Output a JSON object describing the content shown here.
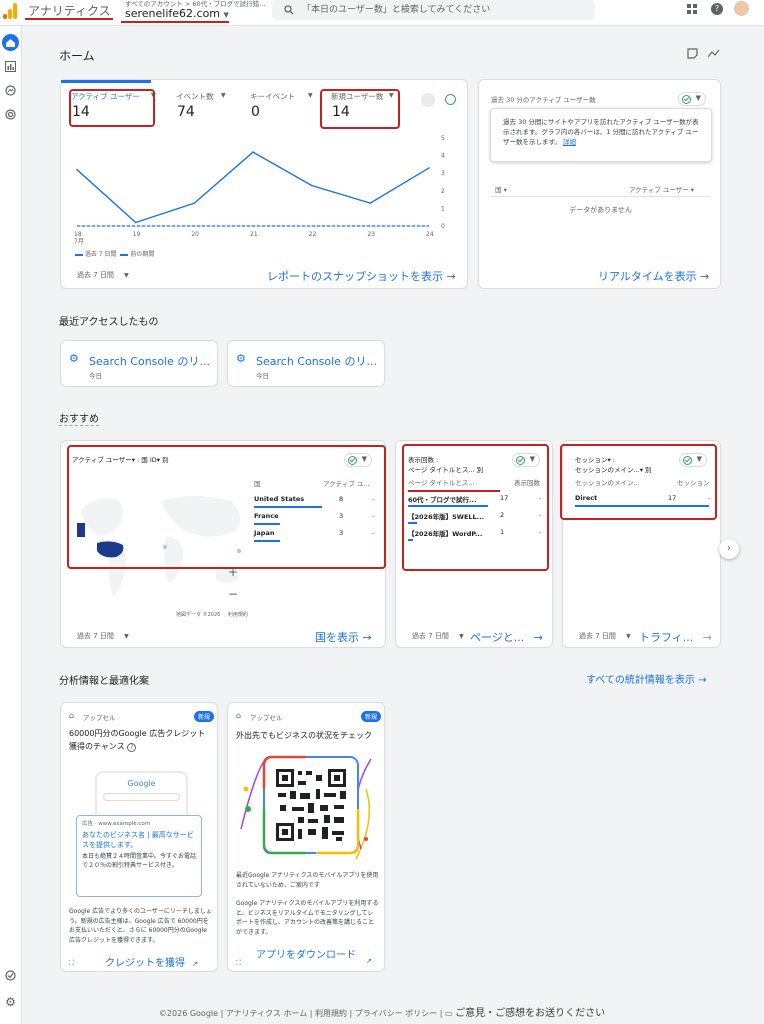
{
  "topbar": {
    "app_title": "アナリティクス",
    "account_path": "すべてのアカウント > 60代・ブログで試行錯...",
    "property_name": "serenelife62.com",
    "search_placeholder": "「本日のユーザー数」と検索してみてください"
  },
  "home": {
    "title": "ホーム"
  },
  "overview_card": {
    "metrics": [
      {
        "label": "アクティブ ユーザー",
        "value": "14"
      },
      {
        "label": "イベント数",
        "value": "74"
      },
      {
        "label": "キーイベント",
        "value": "0"
      },
      {
        "label": "新規ユーザー数",
        "value": "14"
      }
    ],
    "date_range": "過去 7 日間",
    "legend_current": "過去 7 日間",
    "legend_previous": "前の期間",
    "snapshot_link": "レポートのスナップショットを表示"
  },
  "chart_data": {
    "type": "line",
    "x": [
      "18",
      "19",
      "20",
      "21",
      "22",
      "23",
      "24"
    ],
    "x_month_label": "7月",
    "series": [
      {
        "name": "過去 7 日間",
        "values": [
          3.2,
          0.2,
          1.3,
          4.2,
          2.3,
          1.3,
          3.3
        ],
        "color": "#1a73e8",
        "style": "solid"
      },
      {
        "name": "前の期間",
        "values": [
          0,
          0,
          0,
          0,
          0,
          0,
          0
        ],
        "color": "#1a73e8",
        "style": "dashed"
      }
    ],
    "ylim": [
      0,
      5
    ],
    "yticks": [
      "5",
      "4",
      "3",
      "2",
      "1",
      "0"
    ]
  },
  "realtime_card": {
    "title": "過去 30 分のアクティブ ユーザー数",
    "tooltip_text": "過去 30 分間にサイトやアプリを訪れたアクティブ ユーザー数が表示されます。グラフ内の各バーは、1 分間に訪れたアクティブ ユーザー数を示します。",
    "tooltip_link": "詳細",
    "col_country": "国",
    "col_users": "アクティブ ユーザー",
    "empty": "データがありません",
    "link": "リアルタイムを表示"
  },
  "recent": {
    "title": "最近アクセスしたもの",
    "items": [
      {
        "label": "Search Console のリ...",
        "sub": "今日"
      },
      {
        "label": "Search Console のリ...",
        "sub": "今日"
      }
    ]
  },
  "recommend": {
    "title": "おすすめ",
    "country_card": {
      "title": "アクティブ ユーザー▾ : 国 ID▾ 別",
      "col_country": "国",
      "col_users": "アクティブ ユ...",
      "rows": [
        {
          "name": "United States",
          "value": "8",
          "bar": 1.0
        },
        {
          "name": "France",
          "value": "3",
          "bar": 0.375
        },
        {
          "name": "Japan",
          "value": "3",
          "bar": 0.375
        }
      ],
      "map_credit": "地図データ ©2026",
      "map_terms": "利用規約",
      "zoom_in": "+",
      "zoom_out": "−",
      "date_range": "過去 7 日間",
      "link": "国を表示"
    },
    "page_card": {
      "title_line1": "表示回数 :",
      "title_line2": "ページ タイトルとス... 別",
      "col_page": "ページ タイトルとス...",
      "col_views": "表示回数",
      "rows": [
        {
          "name": "60代・ブログで試行...",
          "value": "17",
          "bar": 1.0
        },
        {
          "name": "【2026年版】SWELL...",
          "value": "2",
          "bar": 0.118
        },
        {
          "name": "【2026年版】WordP...",
          "value": "1",
          "bar": 0.059
        }
      ],
      "date_range": "過去 7 日間",
      "link": "ページと..."
    },
    "session_card": {
      "title_line1": "セッション▾ :",
      "title_line2": "セッションのメイン...▾ 別",
      "col_channel": "セッションのメイン...",
      "col_value": "セッション",
      "rows": [
        {
          "name": "Direct",
          "value": "17",
          "bar": 1.0
        }
      ],
      "date_range": "過去 7 日間",
      "link": "トラフィ..."
    }
  },
  "insights": {
    "title": "分析情報と最適化案",
    "all_link": "すべての統計情報を表示",
    "cards": [
      {
        "tag": "アップセル",
        "badge": "新規",
        "title": "60000円分のGoogle 広告クレジット獲得のチャンス",
        "ad_google": "Google",
        "ad_label": "広告 · www.example.com",
        "ad_headline": "あなたのビジネス名 | 最高なサービスを提供します。",
        "ad_body": "本日も絶賛２４時間営業中。今すぐお電話で２０％の割引特典サービス付き。",
        "body": "Google 広告でより多くのユーザーにリーチしましょう。新規の広告主様は、Google 広告で 60000円をお支払いいただくと、さらに 60000円分のGoogle 広告クレジットを獲得できます。",
        "action": "クレジットを獲得"
      },
      {
        "tag": "アップセル",
        "badge": "新規",
        "title": "外出先でもビジネスの状況をチェック",
        "body1": "最近Google アナリティクスのモバイルアプリを使用されていないため、ご案内です",
        "body2": "Google アナリティクスのモバイルアプリを利用すると、ビジネスをリアルタイムでモニタリングしてレポートを作成し、アカウントの改善策を講じることができます。",
        "action": "アプリをダウンロード"
      }
    ]
  },
  "footer": {
    "text": "©2026 Google | アナリティクス ホーム | 利用規約 | プライバシー ポリシー | ",
    "feedback": "ご意見・ご感想をお送りください"
  },
  "colors": {
    "accent": "#1a73e8",
    "highlight_red": "#c5221f",
    "check_green": "#34a853",
    "logo_orange": "#f9ab00",
    "logo_dark": "#e37400"
  }
}
